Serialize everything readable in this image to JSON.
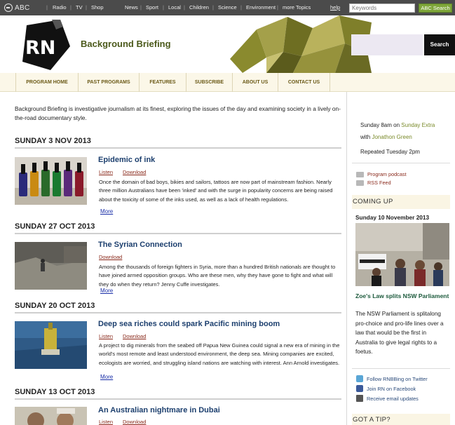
{
  "topbar": {
    "logo_text": "ABC",
    "links": [
      "Radio",
      "TV",
      "Shop",
      "News",
      "Sport",
      "Local",
      "Children",
      "Science",
      "Environment",
      "more Topics"
    ],
    "help": "help",
    "search_placeholder": "Keywords",
    "search_button": "ABC Search"
  },
  "header": {
    "logo_text": "RN",
    "program_title": "Background Briefing",
    "search_button": "Search"
  },
  "program_nav": [
    "PROGRAM HOME",
    "PAST PROGRAMS",
    "FEATURES",
    "SUBSCRIBE",
    "ABOUT US",
    "CONTACT US"
  ],
  "intro": "Background Briefing is investigative journalism at its finest, exploring the issues of the day and examining society in a lively on-the-road documentary style.",
  "stories": [
    {
      "date": "SUNDAY 3 NOV 2013",
      "title": "Epidemic of ink",
      "actions": [
        "Listen",
        "Download"
      ],
      "description": "Once the domain of bad boys, bikies and sailors, tattoos are now part of mainstream fashion. Nearly three million Australians have been 'inked' and with the surge in popularity concerns are being raised about the toxicity of some of the inks used, as well as a lack of health regulations.",
      "more": "More"
    },
    {
      "date": "SUNDAY 27 OCT 2013",
      "title": "The Syrian Connection",
      "actions": [
        "Download"
      ],
      "description": "Among the thousands of foreign fighters in Syria, more than a hundred British nationals are thought to have joined armed opposition groups. Who are these men, why they have gone to fight and what will they do when they return? Jenny Cuffe investigates.",
      "more": "More"
    },
    {
      "date": "SUNDAY 20 OCT 2013",
      "title": "Deep sea riches could spark Pacific mining boom",
      "actions": [
        "Listen",
        "Download"
      ],
      "description": "A project to dig minerals from the seabed off Papua New Guinea could signal a new era of mining in the world's most remote and least understood environment, the deep sea. Mining companies are excited, ecologists are worried, and struggling island nations are watching with interest. Ann Arnold investigates.",
      "more": "More"
    },
    {
      "date": "SUNDAY 13 OCT 2013",
      "title": "An Australian nightmare in Dubai",
      "actions": [
        "Listen",
        "Download"
      ],
      "description": "",
      "more": ""
    }
  ],
  "sidebar": {
    "up_next": {
      "line1_prefix": "Sunday 8am on",
      "line1_link": "Sunday Extra",
      "line2_prefix": "with",
      "line2_link": "Jonathon Green",
      "repeat": "Repeated Tuesday 2pm"
    },
    "feeds": [
      "Program podcast",
      "RSS Feed"
    ],
    "coming_up": {
      "heading": "COMING UP",
      "date": "Sunday 10 November 2013",
      "title": "Zoe's Law splits NSW Parliament",
      "description": "The NSW Parliament is splitalong pro-choice and pro-life lines over a law that would be the first in Australia to give legal rights to a foetus."
    },
    "social": [
      "Follow RNBBing on Twitter",
      "Join RN on Facebook",
      "Receive email updates"
    ],
    "tip_heading": "GOT A TIP?"
  },
  "colors": {
    "topbar": "#4b4b4b",
    "program_title": "#4c5a1c",
    "story_title": "#1c3f6e",
    "action_link": "#8a2a1c",
    "more_link": "#1a2fa8",
    "nav_bg": "#fbf7e8"
  }
}
